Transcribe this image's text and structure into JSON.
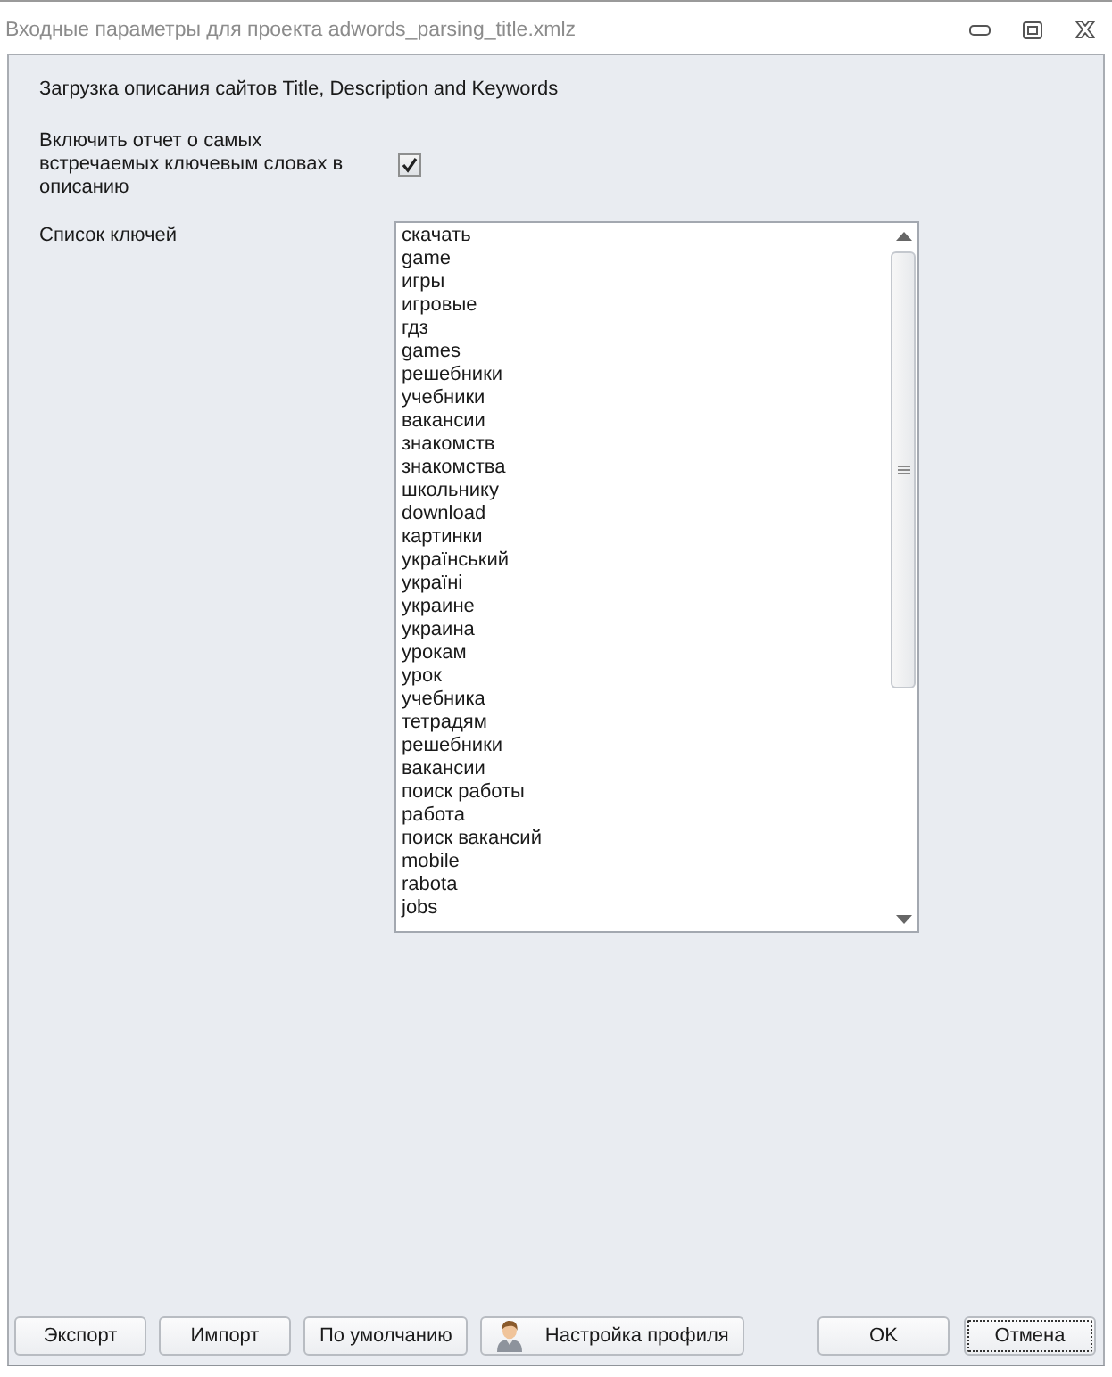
{
  "window": {
    "title": "Входные параметры для проекта adwords_parsing_title.xmlz"
  },
  "heading": "Загрузка описания сайтов Title, Description and Keywords",
  "options": [
    {
      "kind": "checkbox",
      "label": "Включить отчет о самых встречаемых ключевым словах в описанию",
      "checked": true
    }
  ],
  "keyword_list": {
    "label": "Список ключей",
    "items": [
      "скачать",
      "game",
      "игры",
      "игровые",
      "гдз",
      "games",
      "решебники",
      "учебники",
      "вакансии",
      "знакомств",
      "знакомства",
      "школьнику",
      "download",
      "картинки",
      "український",
      "україні",
      "украине",
      "украина",
      "урокам",
      "урок",
      "учебника",
      "тетрадям",
      "решебники",
      "вакансии",
      "поиск работы",
      "работа",
      "поиск вакансий",
      "mobile",
      "rabota",
      "jobs"
    ]
  },
  "footer": {
    "left_buttons": [
      {
        "label": "Экспорт",
        "kind": "text",
        "focused": false
      },
      {
        "label": "Импорт",
        "kind": "text",
        "focused": false
      },
      {
        "label": "По умолчанию",
        "kind": "text",
        "focused": false
      },
      {
        "label": "Настройка профиля",
        "kind": "icon",
        "focused": false
      }
    ],
    "right_buttons": [
      {
        "label": "OK",
        "kind": "text",
        "focused": false
      },
      {
        "label": "Отмена",
        "kind": "text",
        "focused": true
      }
    ]
  }
}
